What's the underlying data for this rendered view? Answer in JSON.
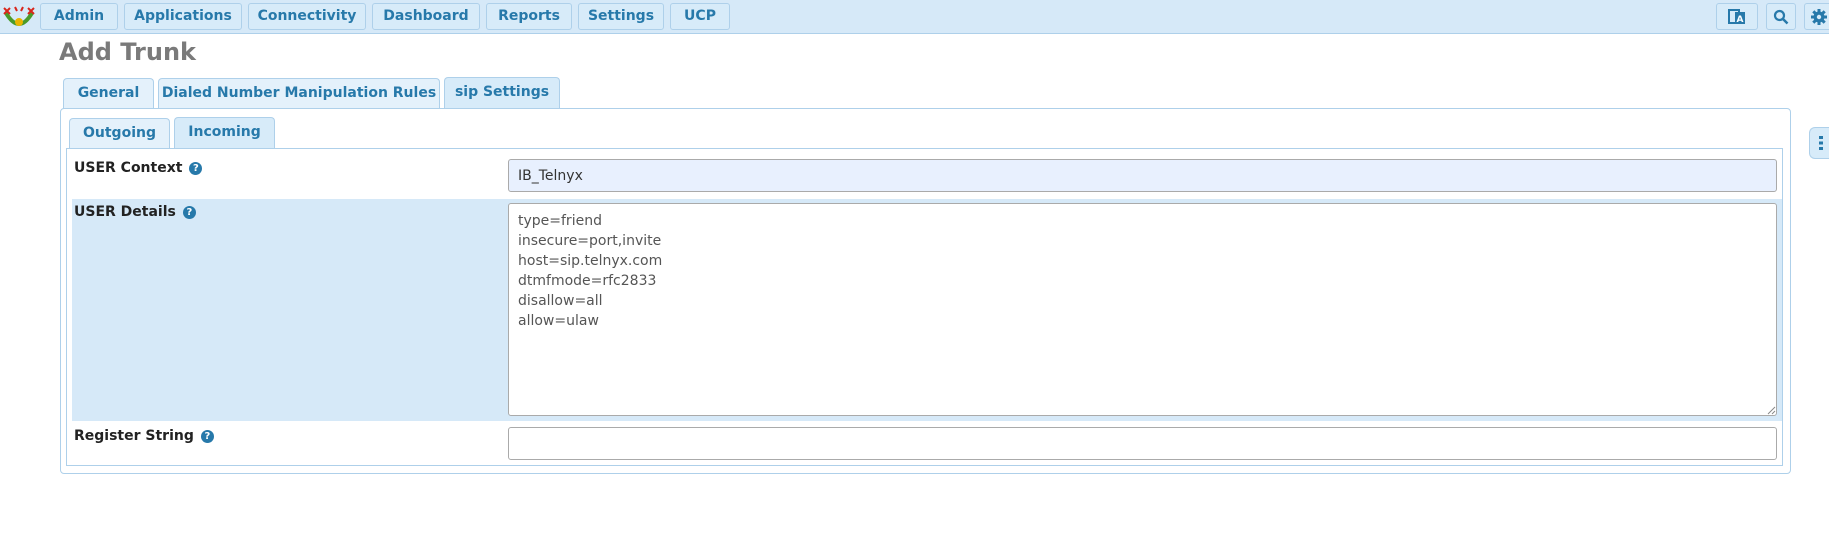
{
  "nav": {
    "items": [
      {
        "label": "Admin"
      },
      {
        "label": "Applications"
      },
      {
        "label": "Connectivity"
      },
      {
        "label": "Dashboard"
      },
      {
        "label": "Reports"
      },
      {
        "label": "Settings"
      },
      {
        "label": "UCP"
      }
    ],
    "icons": [
      "language-icon",
      "search-icon",
      "gear-icon"
    ]
  },
  "page": {
    "title": "Add Trunk"
  },
  "tabs": [
    {
      "label": "General",
      "active": false
    },
    {
      "label": "Dialed Number Manipulation Rules",
      "active": false
    },
    {
      "label": "sip Settings",
      "active": true
    }
  ],
  "subtabs": [
    {
      "label": "Outgoing",
      "active": false
    },
    {
      "label": "Incoming",
      "active": true
    }
  ],
  "fields": {
    "user_context": {
      "label": "USER Context",
      "value": "IB_Telnyx"
    },
    "user_details": {
      "label": "USER Details",
      "value": "type=friend\ninsecure=port,invite\nhost=sip.telnyx.com\ndtmfmode=rfc2833\ndisallow=all\nallow=ulaw"
    },
    "register_string": {
      "label": "Register String",
      "value": ""
    }
  },
  "help_symbol": "?",
  "colors": {
    "accent": "#2779aa",
    "bar_background": "#d6e9f8",
    "border": "#aed0ea",
    "title": "#7a7a7a"
  }
}
